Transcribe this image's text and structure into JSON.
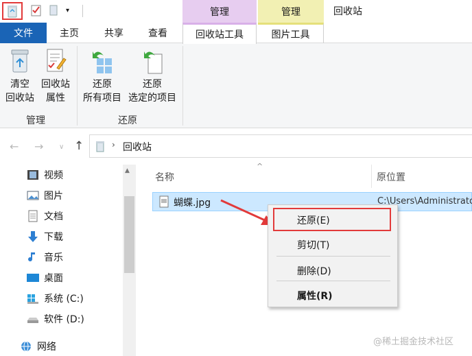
{
  "titlebar": {
    "quick_access_dropdown": "▾",
    "context_manage_1": "管理",
    "context_manage_2": "管理",
    "title": "回收站"
  },
  "tabs": {
    "file": "文件",
    "home": "主页",
    "share": "共享",
    "view": "查看",
    "recycle_tools": "回收站工具",
    "picture_tools": "图片工具"
  },
  "ribbon": {
    "empty_l1": "清空",
    "empty_l2": "回收站",
    "props_l1": "回收站",
    "props_l2": "属性",
    "restore_all_l1": "还原",
    "restore_all_l2": "所有项目",
    "restore_sel_l1": "还原",
    "restore_sel_l2": "选定的项目",
    "group_manage": "管理",
    "group_restore": "还原"
  },
  "address": {
    "path": "回收站"
  },
  "navpane": {
    "items": [
      "视频",
      "图片",
      "文档",
      "下载",
      "音乐",
      "桌面",
      "系统 (C:)",
      "软件 (D:)",
      "网络"
    ]
  },
  "content": {
    "col_name": "名称",
    "col_location": "原位置",
    "file_name": "蝴蝶.jpg",
    "file_location": "C:\\Users\\Administrator"
  },
  "context_menu": {
    "restore": "还原(E)",
    "cut": "剪切(T)",
    "delete": "删除(D)",
    "properties": "属性(R)"
  },
  "watermark": "@稀土掘金技术社区",
  "colors": {
    "file_tab": "#1a64b6",
    "manage_purple": "#e7cdf0",
    "manage_yellow": "#f2f0b3",
    "selection": "#cce8ff",
    "highlight_red": "#e23a3a"
  }
}
